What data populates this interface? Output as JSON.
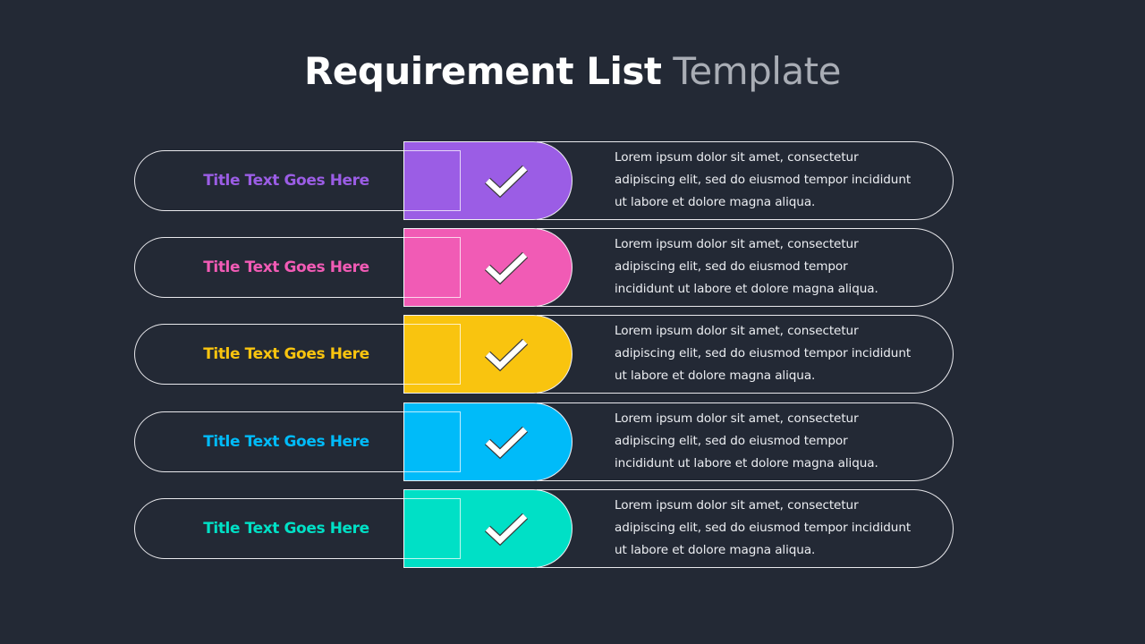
{
  "header": {
    "title_bold": "Requirement List",
    "title_light": "Template"
  },
  "rows": [
    {
      "title": "Title Text Goes Here",
      "color": "#9b5de5",
      "icon": "checkmark-icon",
      "lines": [
        "Lorem ipsum dolor sit amet, consectetur",
        "adipiscing  elit, sed do eiusmod tempor incididunt",
        "ut labore et dolore magna aliqua."
      ]
    },
    {
      "title": "Title Text Goes Here",
      "color": "#f15bb5",
      "icon": "checkmark-icon",
      "lines": [
        "Lorem ipsum dolor sit amet, consectetur",
        "adipiscing  elit, sed do eiusmod tempor",
        "incididunt  ut labore et dolore magna aliqua."
      ]
    },
    {
      "title": "Title Text Goes Here",
      "color": "#f9c40f",
      "icon": "checkmark-icon",
      "lines": [
        "Lorem ipsum dolor sit amet, consectetur",
        "adipiscing  elit, sed do eiusmod tempor incididunt",
        "ut labore et dolore magna aliqua."
      ]
    },
    {
      "title": "Title Text Goes Here",
      "color": "#00bbf9",
      "icon": "checkmark-icon",
      "lines": [
        "Lorem ipsum dolor sit amet, consectetur",
        "adipiscing  elit, sed do eiusmod tempor",
        "incididunt  ut labore et dolore magna aliqua."
      ]
    },
    {
      "title": "Title Text Goes Here",
      "color": "#00e0c6",
      "icon": "checkmark-icon",
      "lines": [
        "Lorem ipsum dolor sit amet, consectetur",
        "adipiscing  elit, sed do eiusmod tempor incididunt",
        "ut labore et dolore magna aliqua."
      ]
    }
  ]
}
